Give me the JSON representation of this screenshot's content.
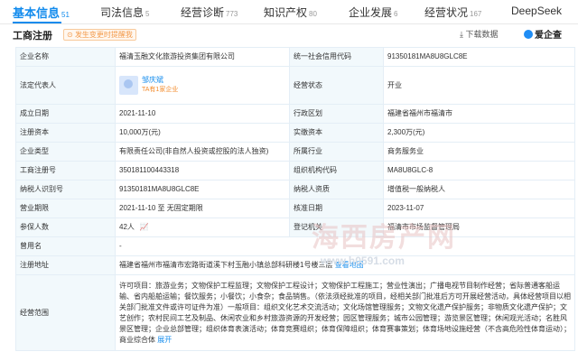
{
  "tabs": [
    {
      "label": "基本信息",
      "count": "51"
    },
    {
      "label": "司法信息",
      "count": "5"
    },
    {
      "label": "经营诊断",
      "count": "773"
    },
    {
      "label": "知识产权",
      "count": "80"
    },
    {
      "label": "企业发展",
      "count": "6"
    },
    {
      "label": "经营状况",
      "count": "167"
    }
  ],
  "deepseek": "DeepSeek",
  "section": {
    "title": "工商注册",
    "warn": "发生变更时提醒我",
    "download": "下载数据",
    "brand": "爱企查"
  },
  "rows": {
    "r1": {
      "l1": "企业名称",
      "v1": "福清玉融文化旅游投资集团有限公司",
      "l2": "统一社会信用代码",
      "v2": "91350181MA8U8GLC8E"
    },
    "r2": {
      "l1": "法定代表人",
      "name": "邹庆斌",
      "sub": "TA有1家企业",
      "l2": "经营状态",
      "v2": "开业"
    },
    "r3": {
      "l1": "成立日期",
      "v1": "2021-11-10",
      "l2": "行政区划",
      "v2": "福建省福州市福清市"
    },
    "r4": {
      "l1": "注册资本",
      "v1": "10,000万(元)",
      "l2": "实缴资本",
      "v2": "2,300万(元)"
    },
    "r5": {
      "l1": "企业类型",
      "v1": "有限责任公司(非自然人投资或控股的法人独资)",
      "l2": "所属行业",
      "v2": "商务服务业"
    },
    "r6": {
      "l1": "工商注册号",
      "v1": "350181100443318",
      "l2": "组织机构代码",
      "v2": "MA8U8GLC-8"
    },
    "r7": {
      "l1": "纳税人识别号",
      "v1": "91350181MA8U8GLC8E",
      "l2": "纳税人资质",
      "v2": "增值税一般纳税人"
    },
    "r8": {
      "l1": "营业期限",
      "v1": "2021-11-10 至 无固定期限",
      "l2": "核准日期",
      "v2": "2023-11-07"
    },
    "r9": {
      "l1": "参保人数",
      "v1": "42人",
      "l2": "登记机关",
      "v2": "福清市市场监督管理局"
    },
    "r10": {
      "l1": "曾用名",
      "v1": "-"
    },
    "r11": {
      "l1": "注册地址",
      "v1": "福建省福州市福清市宏路街道溪下村玉融小镇总部科研楼1号楼三层",
      "link": "查看地图"
    },
    "r12": {
      "l1": "经营范围",
      "v1": "许可项目：旅游业务；文物保护工程监理；文物保护工程设计；文物保护工程施工；营业性演出；广播电视节目制作经营；省际普通客船运输、省内船舶运输；餐饮服务；小餐饮；小食杂；食品销售。（依法须经批准的项目，经相关部门批准后方可开展经营活动，具体经营项目以相关部门批准文件或许可证件为准）一般项目：组织文化艺术交流活动；文化场馆管理服务；文物文化遗产保护服务；非物质文化遗产保护；文艺创作；农村民间工艺及制品、休闲农业和乡村旅游资源的开发经营；园区管理服务；城市公园管理；游览景区管理；休闲观光活动；名胜风景区管理；企业总部管理；组织体育表演活动；体育竞赛组织；体育保障组织；体育赛事策划；体育场地设施经营（不含高危险性体育运动）；商业综合体",
      "more": "展开"
    }
  },
  "watermark": {
    "title": "海西房产网",
    "url": "www.h0591.com"
  }
}
